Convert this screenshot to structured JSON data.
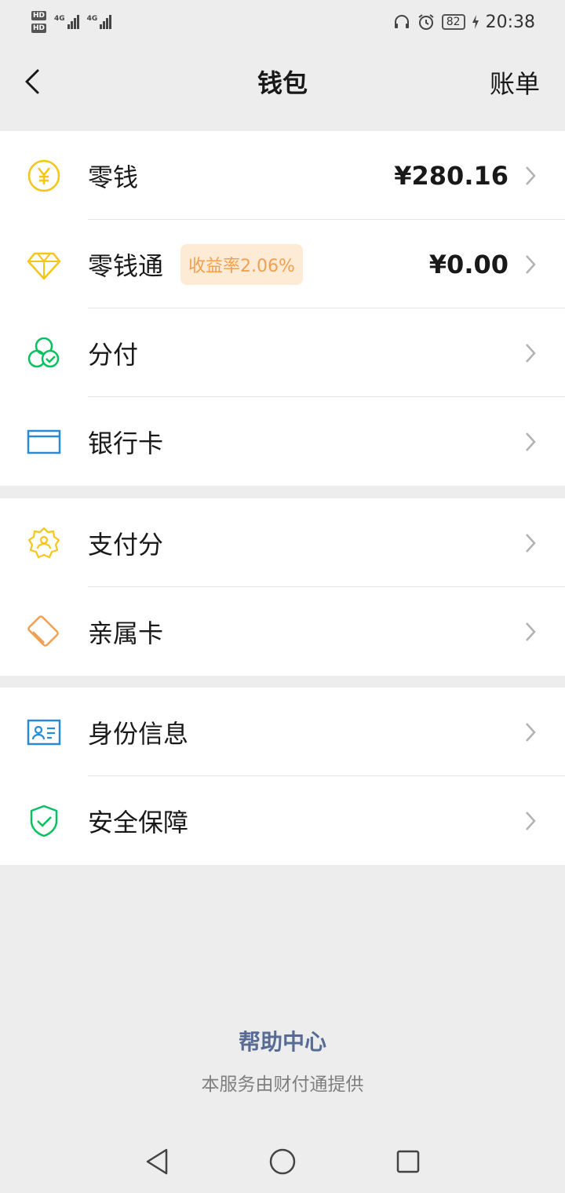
{
  "status_bar": {
    "hd1": "HD",
    "hd2": "HD",
    "net1": "4G",
    "net2": "4G",
    "battery": "82",
    "time": "20:38"
  },
  "nav": {
    "title": "钱包",
    "bill": "账单"
  },
  "groups": [
    {
      "items": [
        {
          "label": "零钱",
          "value": "¥280.16",
          "icon": "yuan-coin-icon"
        },
        {
          "label": "零钱通",
          "badge": "收益率2.06%",
          "value": "¥0.00",
          "icon": "diamond-icon"
        },
        {
          "label": "分付",
          "icon": "fenfu-circles-icon"
        },
        {
          "label": "银行卡",
          "icon": "bank-card-icon"
        }
      ]
    },
    {
      "items": [
        {
          "label": "支付分",
          "icon": "score-badge-icon"
        },
        {
          "label": "亲属卡",
          "icon": "family-card-icon"
        }
      ]
    },
    {
      "items": [
        {
          "label": "身份信息",
          "icon": "id-card-icon"
        },
        {
          "label": "安全保障",
          "icon": "shield-check-icon"
        }
      ]
    }
  ],
  "footer": {
    "help": "帮助中心",
    "provider": "本服务由财付通提供"
  },
  "colors": {
    "background": "#ededed",
    "link": "#576b95",
    "gold": "#f5c518",
    "green": "#07c160",
    "blue": "#2b8ad8",
    "orange": "#f0a050"
  }
}
